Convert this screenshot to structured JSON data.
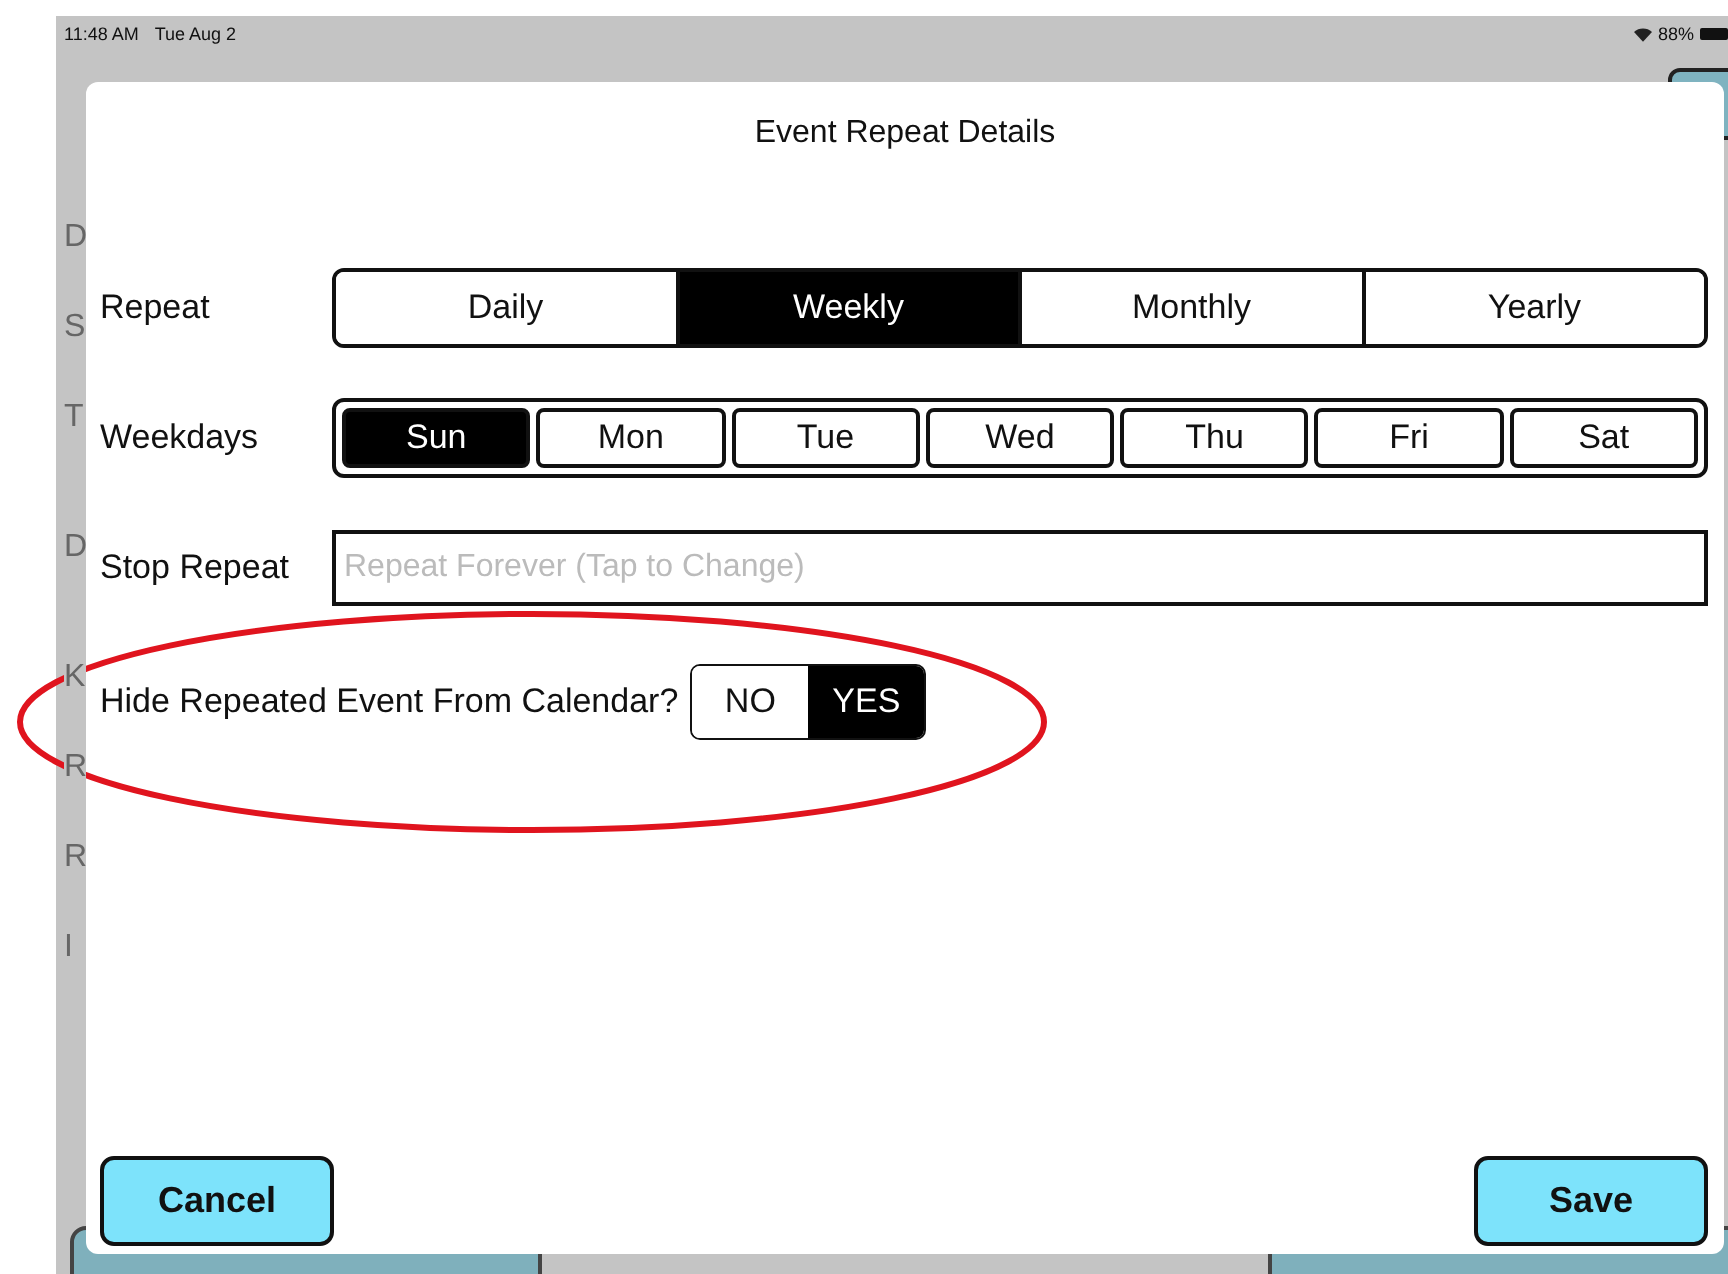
{
  "status_bar": {
    "time": "11:48 AM",
    "date": "Tue Aug 2",
    "battery": "88%"
  },
  "background": {
    "labels": [
      "D",
      "S",
      "T",
      "D",
      "K",
      "R",
      "R",
      "I"
    ]
  },
  "dialog": {
    "title": "Event Repeat Details",
    "repeat": {
      "label": "Repeat",
      "options": [
        {
          "label": "Daily",
          "selected": false
        },
        {
          "label": "Weekly",
          "selected": true
        },
        {
          "label": "Monthly",
          "selected": false
        },
        {
          "label": "Yearly",
          "selected": false
        }
      ]
    },
    "weekdays": {
      "label": "Weekdays",
      "days": [
        {
          "label": "Sun",
          "selected": true
        },
        {
          "label": "Mon",
          "selected": false
        },
        {
          "label": "Tue",
          "selected": false
        },
        {
          "label": "Wed",
          "selected": false
        },
        {
          "label": "Thu",
          "selected": false
        },
        {
          "label": "Fri",
          "selected": false
        },
        {
          "label": "Sat",
          "selected": false
        }
      ]
    },
    "stop_repeat": {
      "label": "Stop Repeat",
      "placeholder": "Repeat Forever (Tap to Change)"
    },
    "hide": {
      "label": "Hide Repeated Event From Calendar?",
      "options": [
        {
          "label": "NO",
          "selected": false
        },
        {
          "label": "YES",
          "selected": true
        }
      ],
      "highlighted": true
    },
    "buttons": [
      {
        "label": "Cancel"
      },
      {
        "label": "Save"
      }
    ]
  }
}
